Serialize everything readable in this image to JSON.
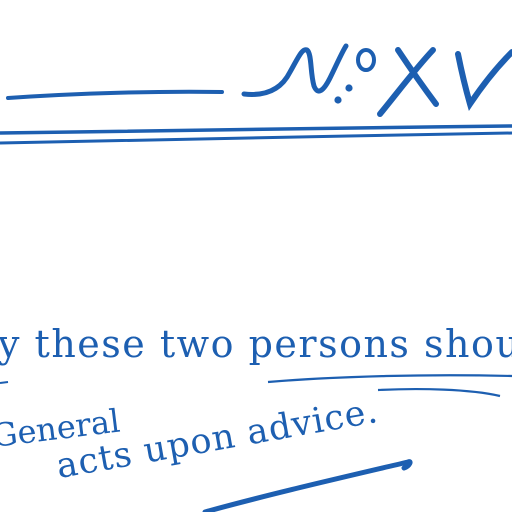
{
  "heading": {
    "number_label": "№ XV"
  },
  "lines": [
    {
      "text": "y these two persons shoul"
    },
    {
      "text": "General"
    },
    {
      "text": "acts upon advice."
    }
  ],
  "colors": {
    "ink": "#1d5fb1",
    "paper": "#ffffff"
  }
}
